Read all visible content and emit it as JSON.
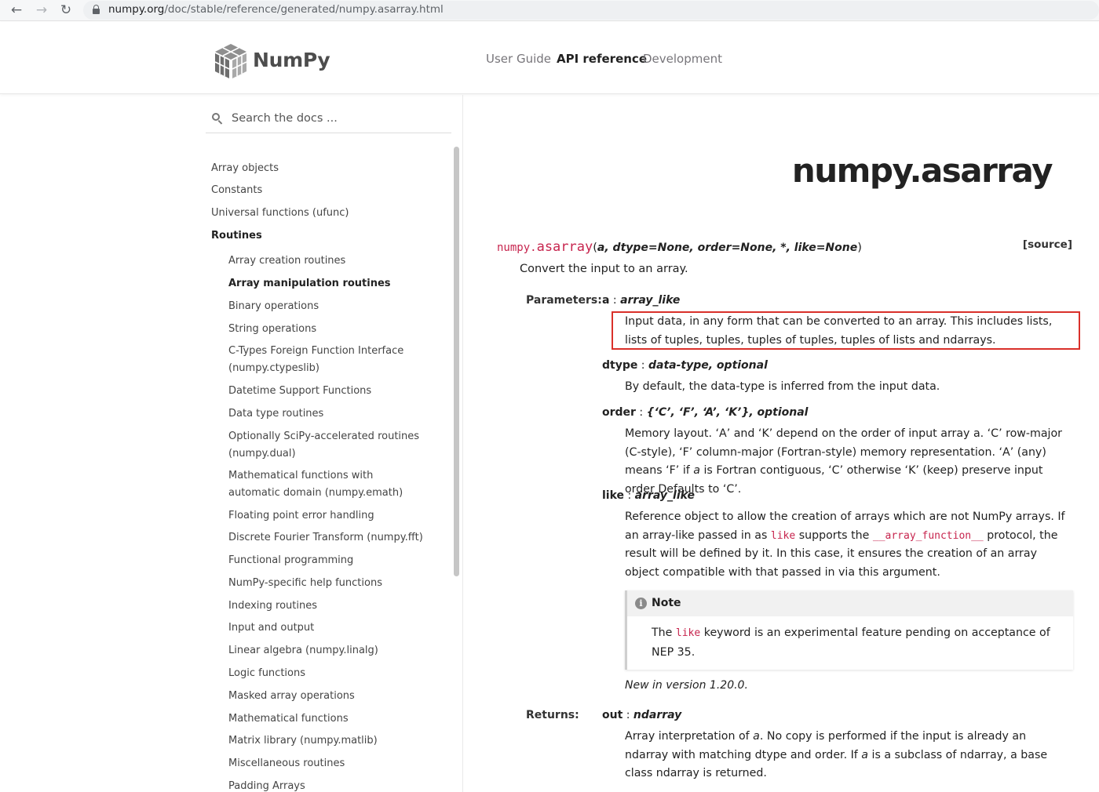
{
  "browser": {
    "url_domain": "numpy.org",
    "url_path": "/doc/stable/reference/generated/numpy.asarray.html"
  },
  "header": {
    "logo_text": "NumPy",
    "nav": [
      {
        "label": "User Guide",
        "active": false
      },
      {
        "label": "API reference",
        "active": true
      },
      {
        "label": "Development",
        "active": false
      }
    ]
  },
  "sidebar": {
    "search_placeholder": "Search the docs ...",
    "items": [
      {
        "label": "Array objects",
        "level": 1
      },
      {
        "label": "Constants",
        "level": 1
      },
      {
        "label": "Universal functions (ufunc)",
        "level": 1
      },
      {
        "label": "Routines",
        "level": 1,
        "bold": true
      },
      {
        "label": "Array creation routines",
        "level": 2
      },
      {
        "label": "Array manipulation routines",
        "level": 2,
        "bold": true
      },
      {
        "label": "Binary operations",
        "level": 2
      },
      {
        "label": "String operations",
        "level": 2
      },
      {
        "label": "C-Types Foreign Function Interface",
        "label2": "(numpy.ctypeslib)",
        "level": 2
      },
      {
        "label": "Datetime Support Functions",
        "level": 2
      },
      {
        "label": "Data type routines",
        "level": 2
      },
      {
        "label": "Optionally SciPy-accelerated routines",
        "label2": "(numpy.dual)",
        "level": 2
      },
      {
        "label": "Mathematical functions with",
        "label2": "automatic domain (numpy.emath)",
        "level": 2
      },
      {
        "label": "Floating point error handling",
        "level": 2
      },
      {
        "label": "Discrete Fourier Transform (numpy.fft)",
        "level": 2
      },
      {
        "label": "Functional programming",
        "level": 2
      },
      {
        "label": "NumPy-specific help functions",
        "level": 2
      },
      {
        "label": "Indexing routines",
        "level": 2
      },
      {
        "label": "Input and output",
        "level": 2
      },
      {
        "label": "Linear algebra (numpy.linalg)",
        "level": 2
      },
      {
        "label": "Logic functions",
        "level": 2
      },
      {
        "label": "Masked array operations",
        "level": 2
      },
      {
        "label": "Mathematical functions",
        "level": 2
      },
      {
        "label": "Matrix library (numpy.matlib)",
        "level": 2
      },
      {
        "label": "Miscellaneous routines",
        "level": 2
      },
      {
        "label": "Padding Arrays",
        "level": 2
      }
    ]
  },
  "main": {
    "title": "numpy.asarray",
    "signature": {
      "module": "numpy.",
      "name": "asarray",
      "open": "(",
      "params": "a, dtype=None, order=None, *, like=None",
      "close": ")"
    },
    "source_label": "[source]",
    "summary": "Convert the input to an array.",
    "parameters_label": "Parameters:",
    "returns_label": "Returns:",
    "params": {
      "a": {
        "name": "a",
        "sep": " : ",
        "type": "array_like",
        "desc": "Input data, in any form that can be converted to an array. This includes lists, lists of tuples, tuples, tuples of tuples, tuples of lists and ndarrays."
      },
      "dtype": {
        "name": "dtype",
        "sep": " : ",
        "type": "data-type, optional",
        "desc": "By default, the data-type is inferred from the input data."
      },
      "order": {
        "name": "order",
        "sep": " : ",
        "type": "{‘C’, ‘F’, ‘A’, ‘K’}, optional",
        "desc_1": "Memory layout. ‘A’ and ‘K’ depend on the order of input array a. ‘C’ row-major (C-style), ‘F’ column-major (Fortran-style) memory representation. ‘A’ (any) means ‘F’ if ",
        "desc_em": "a",
        "desc_2": " is Fortran contiguous, ‘C’ otherwise ‘K’ (keep) preserve input order Defaults to ‘C’."
      },
      "like": {
        "name": "like",
        "sep": " : ",
        "type": "array_like",
        "desc_1": "Reference object to allow the creation of arrays which are not NumPy arrays. If an array-like passed in as ",
        "desc_code1": "like",
        "desc_2": " supports the ",
        "desc_code2": "__array_function__",
        "desc_3": " protocol, the result will be defined by it. In this case, it ensures the creation of an array object compatible with that passed in via this argument."
      }
    },
    "note": {
      "icon": "i",
      "title": "Note",
      "body_1": "The ",
      "body_code": "like",
      "body_2": " keyword is an experimental feature pending on acceptance of NEP 35."
    },
    "versionadded": "New in version 1.20.0.",
    "returns": {
      "name": "out",
      "sep": " : ",
      "type": "ndarray",
      "desc_1": "Array interpretation of ",
      "desc_em1": "a",
      "desc_2": ". No copy is performed if the input is already an ndarray with matching dtype and order. If ",
      "desc_em2": "a",
      "desc_3": " is a subclass of ndarray, a base class ndarray is returned."
    }
  }
}
